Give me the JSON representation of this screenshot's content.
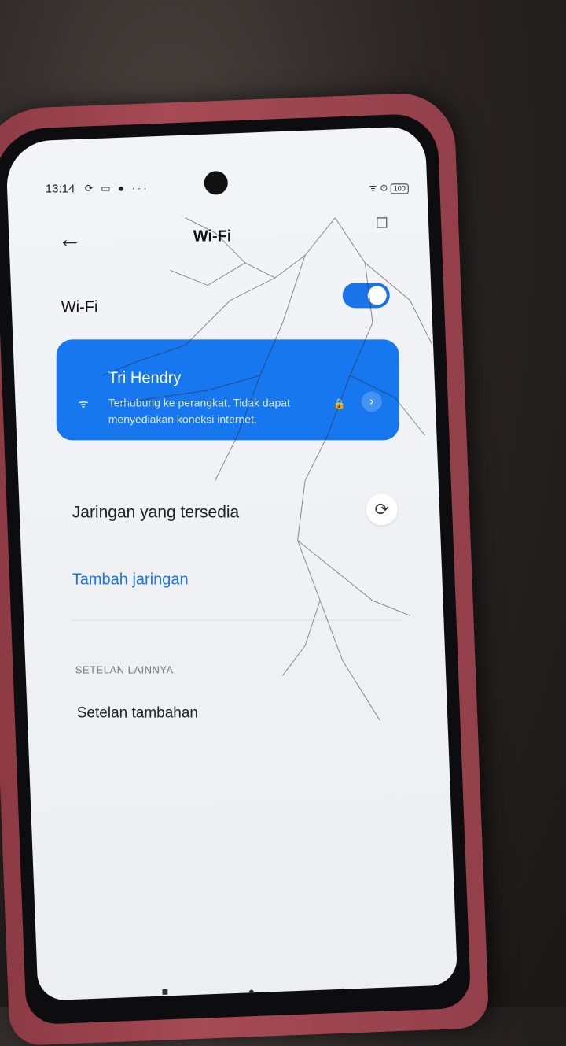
{
  "status_bar": {
    "time": "13:14",
    "notification_icons": "⟳ ▭ ● ···",
    "right_icons": "ᯤ ⊙",
    "battery": "100"
  },
  "header": {
    "back_glyph": "←",
    "title": "Wi-Fi",
    "edge_glyph": "☐"
  },
  "wifi": {
    "label": "Wi-Fi",
    "enabled": true
  },
  "connected_network": {
    "name": "Tri Hendry",
    "status": "Terhubung ke perangkat. Tidak dapat menyediakan koneksi internet.",
    "wifi_glyph": "ᯤ",
    "lock_glyph": "🔒",
    "chevron_glyph": "›"
  },
  "available_networks": {
    "heading": "Jaringan yang tersedia",
    "refresh_glyph": "⟳",
    "add_label": "Tambah jaringan"
  },
  "more_settings": {
    "section_title": "SETELAN LAINNYA",
    "item_label": "Setelan tambahan"
  },
  "nav_bar": {
    "recent_glyph": "■",
    "home_glyph": "●",
    "back_glyph": "◀"
  },
  "colors": {
    "accent": "#1a73e8",
    "card": "#1677ee"
  }
}
